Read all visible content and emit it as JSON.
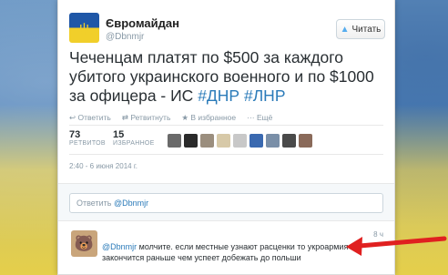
{
  "account": {
    "name": "Євромайдан",
    "handle": "@Dbnmjr"
  },
  "follow_label": "Читать",
  "tweet": {
    "text_before": "Чеченцам платят по $500 за каждого убитого украинского военного и по $1000 за офицера - ИС ",
    "hashtag1": "#ДНР",
    "hashtag2": "#ЛНР"
  },
  "actions": {
    "reply": "Ответить",
    "retweet": "Ретвитнуть",
    "favorite": "В избранное",
    "more": "Ещё"
  },
  "stats": {
    "retweets": {
      "count": "73",
      "label": "РЕТВИТОВ"
    },
    "favorites": {
      "count": "15",
      "label": "ИЗБРАННОЕ"
    }
  },
  "timestamp": "2:40 - 6 июня 2014 г.",
  "reply_box": {
    "prefix": "Ответить ",
    "mention": "@Dbnmjr"
  },
  "reply_tweet": {
    "time": "8 ч",
    "mention": "@Dbnmjr",
    "text": " молчите. если местные узнают расценки то укроармия закончится раньше чем успеет добежать до польши"
  },
  "colors": {
    "accent": "#2b7bb9",
    "annotation": "#e02020"
  }
}
